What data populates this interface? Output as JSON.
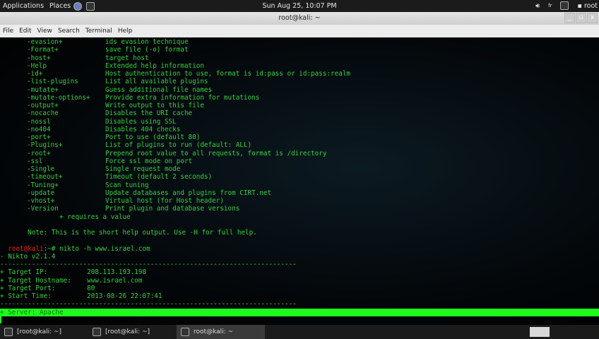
{
  "topbar": {
    "applications": "Applications",
    "places": "Places",
    "clock": "Sun Aug 25, 10:07 PM",
    "keyboard": "fr",
    "user": "root"
  },
  "window": {
    "title": "root@kali: ~",
    "min": "_",
    "max": "▫",
    "close": "x"
  },
  "menu": [
    "File",
    "Edit",
    "View",
    "Search",
    "Terminal",
    "Help"
  ],
  "options": [
    [
      "-evasion+",
      "ids evasion technique"
    ],
    [
      "-Format+",
      "save file (-o) format"
    ],
    [
      "-host+",
      "target host"
    ],
    [
      "-Help",
      "Extended help information"
    ],
    [
      "-id+",
      "Host authentication to use, format is id:pass or id:pass:realm"
    ],
    [
      "-list-plugins",
      "List all available plugins"
    ],
    [
      "-mutate+",
      "Guess additional file names"
    ],
    [
      "-mutate-options+",
      "Provide extra information for mutations"
    ],
    [
      "-output+",
      "Write output to this file"
    ],
    [
      "-nocache",
      "Disables the URI cache"
    ],
    [
      "-nossl",
      "Disables using SSL"
    ],
    [
      "-no404",
      "Disables 404 checks"
    ],
    [
      "-port+",
      "Port to use (default 80)"
    ],
    [
      "-Plugins+",
      "List of plugins to run (default: ALL)"
    ],
    [
      "-root+",
      "Prepend root value to all requests, format is /directory"
    ],
    [
      "-ssl",
      "Force ssl mode on port"
    ],
    [
      "-Single",
      "Single request mode"
    ],
    [
      "-timeout+",
      "Timeout (default 2 seconds)"
    ],
    [
      "-Tuning+",
      "Scan tuning"
    ],
    [
      "-update",
      "Update databases and plugins from CIRT.net"
    ],
    [
      "-vhost+",
      "Virtual host (for Host header)"
    ],
    [
      "-Version",
      "Print plugin and database versions"
    ]
  ],
  "requires": "               + requires a value",
  "note": "       Note: This is the short help output. Use -H for full help.",
  "prompt": {
    "user": "root@kali",
    "path": ":~# ",
    "command": "nikto -h www.israel.com"
  },
  "output": {
    "version": "- Nikto v2.1.4",
    "sep": "---------------------------------------------------------------------------",
    "ip": "+ Target IP:          208.113.193.198",
    "hostname": "+ Target Hostname:    www.israel.com",
    "port": "+ Target Port:        80",
    "start": "+ Start Time:         2013-08-26 22:07:41",
    "server": "+ Server: Apache"
  },
  "tasks": [
    "[root@kali: ~]",
    "[root@kali: ~]",
    "root@kali: ~"
  ]
}
